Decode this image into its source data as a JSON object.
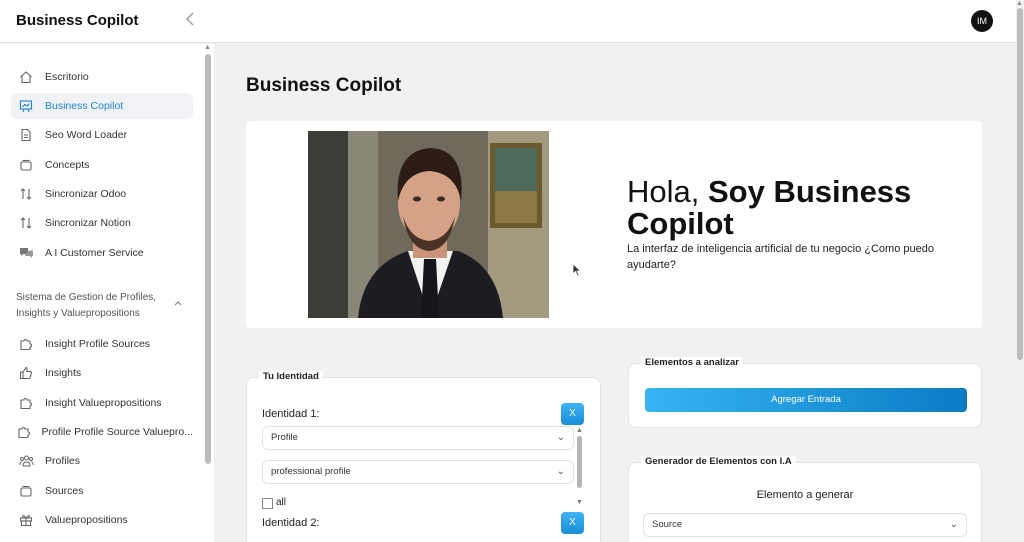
{
  "header": {
    "brand": "Business Copilot",
    "avatar_initials": "IM"
  },
  "sidebar": {
    "items": [
      {
        "label": "Escritorio",
        "icon": "home-icon"
      },
      {
        "label": "Business Copilot",
        "icon": "presentation-icon",
        "active": true
      },
      {
        "label": "Seo Word Loader",
        "icon": "document-icon"
      },
      {
        "label": "Concepts",
        "icon": "layers-icon"
      },
      {
        "label": "Sincronizar Odoo",
        "icon": "sync-arrows-icon"
      },
      {
        "label": "Sincronizar Notion",
        "icon": "sync-arrows-icon"
      },
      {
        "label": "A I Customer Service",
        "icon": "chat-bubbles-icon"
      }
    ],
    "section_title": "Sistema de Gestion de Profiles, Insights y Valuepropositions",
    "section_items": [
      {
        "label": "Insight Profile Sources",
        "icon": "puzzle-icon"
      },
      {
        "label": "Insights",
        "icon": "thumbs-up-icon"
      },
      {
        "label": "Insight Valuepropositions",
        "icon": "puzzle-icon"
      },
      {
        "label": "Profile Profile Source Valuepro...",
        "icon": "puzzle-icon"
      },
      {
        "label": "Profiles",
        "icon": "users-icon"
      },
      {
        "label": "Sources",
        "icon": "layers-icon"
      },
      {
        "label": "Valuepropositions",
        "icon": "gift-icon"
      }
    ]
  },
  "main": {
    "title": "Business Copilot",
    "hero": {
      "greeting_prefix": "Hola, ",
      "greeting_bold": "Soy Business Copilot",
      "subtitle": "La interfaz de inteligencia artificial de tu negocio ¿Como puedo ayudarte?"
    },
    "identity_card": {
      "legend": "Tu Identidad",
      "identity1_label": "Identidad 1:",
      "remove_label": "X",
      "select1_value": "Profile",
      "select2_value": "professional profile",
      "checkbox_label": "all",
      "identity2_label": "Identidad 2:"
    },
    "elements_card": {
      "legend": "Elementos a analizar",
      "add_button": "Agregar Entrada"
    },
    "generator_card": {
      "legend": "Generador de Elementos con I.A",
      "title": "Elemento a generar",
      "select_value": "Source"
    }
  },
  "colors": {
    "accent": "#1f84c6",
    "button_gradient_start": "#36b4f4",
    "button_gradient_end": "#0a7bc4"
  }
}
